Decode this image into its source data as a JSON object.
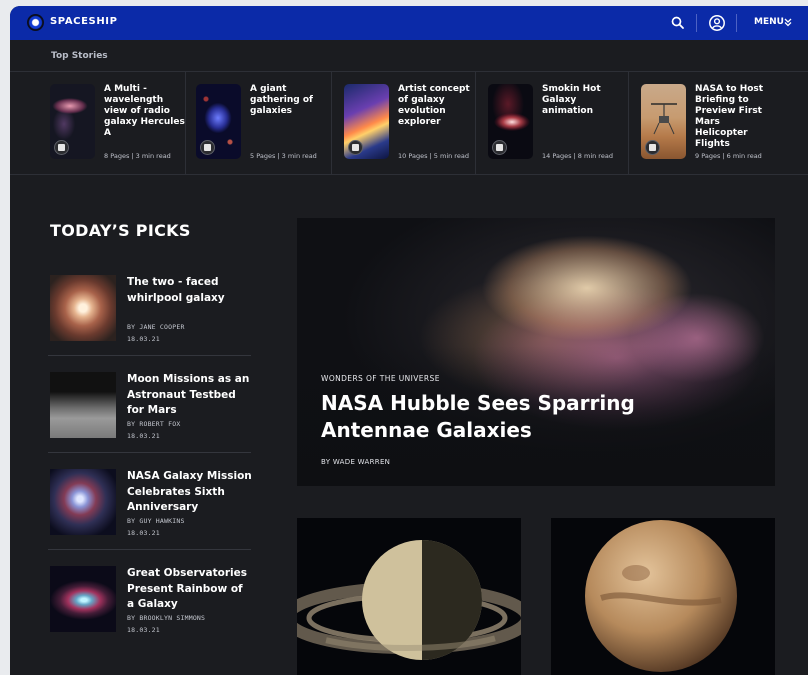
{
  "header": {
    "logo_text": "SPACESHIP",
    "menu_label": "MENU"
  },
  "top_stories": {
    "label": "Top Stories",
    "items": [
      {
        "title": "A Multi - wavelength view of radio galaxy Hercules A",
        "meta": "8 Pages | 3 min read"
      },
      {
        "title": "A giant gathering of galaxies",
        "meta": "5 Pages | 3 min read"
      },
      {
        "title": "Artist concept of galaxy evolution explorer",
        "meta": "10 Pages | 5 min read"
      },
      {
        "title": "Smokin Hot Galaxy animation",
        "meta": "14 Pages | 8 min read"
      },
      {
        "title": "NASA to Host Briefing to Preview First Mars Helicopter Flights",
        "meta": "9 Pages | 6 min read"
      }
    ]
  },
  "todays_picks": {
    "heading": "TODAY’S PICKS",
    "items": [
      {
        "title": "The two - faced whirlpool galaxy",
        "author": "BY JANE COOPER",
        "date": "18.03.21"
      },
      {
        "title": "Moon Missions as an Astronaut Testbed for Mars",
        "author": "BY ROBERT FOX",
        "date": "18.03.21"
      },
      {
        "title": "NASA Galaxy Mission Celebrates Sixth Anniversary",
        "author": "BY GUY HAWKINS",
        "date": "18.03.21"
      },
      {
        "title": "Great Observatories Present Rainbow of a Galaxy",
        "author": "BY BROOKLYN SIMMONS",
        "date": "18.03.21"
      }
    ]
  },
  "hero": {
    "kicker": "WONDERS OF THE UNIVERSE",
    "title": "NASA Hubble Sees Sparring Antennae Galaxies",
    "author": "BY WADE WARREN"
  },
  "colors": {
    "header_bg": "#0b2aa8",
    "page_bg": "#1b1c20",
    "divider": "#2d2f36"
  },
  "icons": {
    "search": "search-icon",
    "user": "user-circle-icon",
    "menu_chevron": "double-chevron-down-icon",
    "story_badge": "story-pages-icon"
  }
}
